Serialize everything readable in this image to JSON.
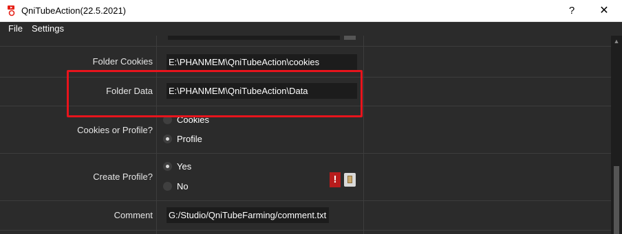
{
  "window": {
    "title": "QniTubeAction(22.5.2021)",
    "help_label": "?",
    "close_label": "✕",
    "icon": "app-youtube-icon"
  },
  "menu": [
    {
      "label": "File"
    },
    {
      "label": "Settings"
    }
  ],
  "settings": {
    "folder_cookies": {
      "label": "Folder Cookies",
      "value": "E:\\PHANMEM\\QniTubeAction\\cookies"
    },
    "folder_data": {
      "label": "Folder Data",
      "value": "E:\\PHANMEM\\QniTubeAction\\Data"
    },
    "cookies_or_profile": {
      "label": "Cookies or Profile?",
      "options": [
        {
          "label": "Cookies",
          "checked": false
        },
        {
          "label": "Profile",
          "checked": true
        }
      ]
    },
    "create_profile": {
      "label": "Create Profile?",
      "options": [
        {
          "label": "Yes",
          "checked": true
        },
        {
          "label": "No",
          "checked": false
        }
      ]
    },
    "comment": {
      "label": "Comment",
      "value": "G:/Studio/QniTubeFarming/comment.txt",
      "warning_label": "!",
      "browse_icon": "file-icon"
    }
  },
  "colors": {
    "highlight": "#e8141c",
    "background": "#2b2b2b",
    "input_bg": "#1c1c1c"
  }
}
